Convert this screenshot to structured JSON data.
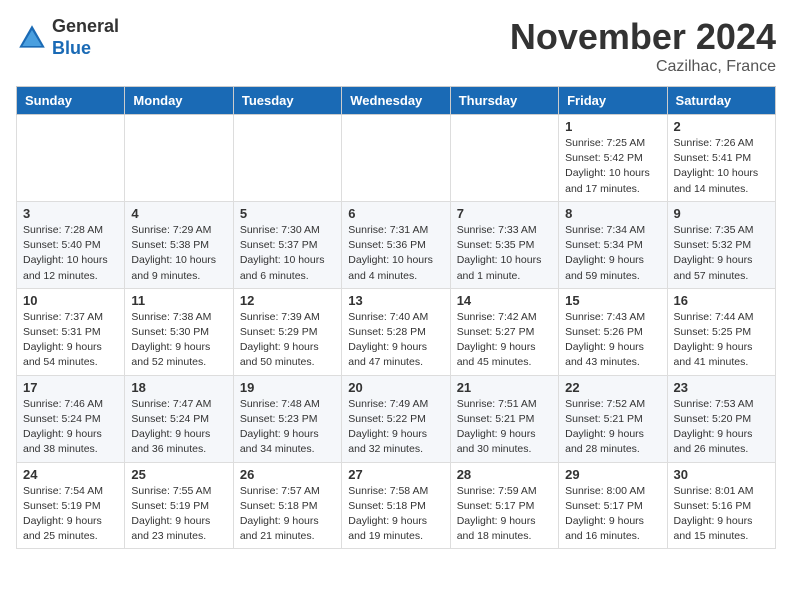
{
  "logo": {
    "line1": "General",
    "line2": "Blue"
  },
  "title": "November 2024",
  "location": "Cazilhac, France",
  "weekdays": [
    "Sunday",
    "Monday",
    "Tuesday",
    "Wednesday",
    "Thursday",
    "Friday",
    "Saturday"
  ],
  "weeks": [
    [
      null,
      null,
      null,
      null,
      null,
      {
        "day": "1",
        "sunrise": "Sunrise: 7:25 AM",
        "sunset": "Sunset: 5:42 PM",
        "daylight": "Daylight: 10 hours and 17 minutes."
      },
      {
        "day": "2",
        "sunrise": "Sunrise: 7:26 AM",
        "sunset": "Sunset: 5:41 PM",
        "daylight": "Daylight: 10 hours and 14 minutes."
      }
    ],
    [
      {
        "day": "3",
        "sunrise": "Sunrise: 7:28 AM",
        "sunset": "Sunset: 5:40 PM",
        "daylight": "Daylight: 10 hours and 12 minutes."
      },
      {
        "day": "4",
        "sunrise": "Sunrise: 7:29 AM",
        "sunset": "Sunset: 5:38 PM",
        "daylight": "Daylight: 10 hours and 9 minutes."
      },
      {
        "day": "5",
        "sunrise": "Sunrise: 7:30 AM",
        "sunset": "Sunset: 5:37 PM",
        "daylight": "Daylight: 10 hours and 6 minutes."
      },
      {
        "day": "6",
        "sunrise": "Sunrise: 7:31 AM",
        "sunset": "Sunset: 5:36 PM",
        "daylight": "Daylight: 10 hours and 4 minutes."
      },
      {
        "day": "7",
        "sunrise": "Sunrise: 7:33 AM",
        "sunset": "Sunset: 5:35 PM",
        "daylight": "Daylight: 10 hours and 1 minute."
      },
      {
        "day": "8",
        "sunrise": "Sunrise: 7:34 AM",
        "sunset": "Sunset: 5:34 PM",
        "daylight": "Daylight: 9 hours and 59 minutes."
      },
      {
        "day": "9",
        "sunrise": "Sunrise: 7:35 AM",
        "sunset": "Sunset: 5:32 PM",
        "daylight": "Daylight: 9 hours and 57 minutes."
      }
    ],
    [
      {
        "day": "10",
        "sunrise": "Sunrise: 7:37 AM",
        "sunset": "Sunset: 5:31 PM",
        "daylight": "Daylight: 9 hours and 54 minutes."
      },
      {
        "day": "11",
        "sunrise": "Sunrise: 7:38 AM",
        "sunset": "Sunset: 5:30 PM",
        "daylight": "Daylight: 9 hours and 52 minutes."
      },
      {
        "day": "12",
        "sunrise": "Sunrise: 7:39 AM",
        "sunset": "Sunset: 5:29 PM",
        "daylight": "Daylight: 9 hours and 50 minutes."
      },
      {
        "day": "13",
        "sunrise": "Sunrise: 7:40 AM",
        "sunset": "Sunset: 5:28 PM",
        "daylight": "Daylight: 9 hours and 47 minutes."
      },
      {
        "day": "14",
        "sunrise": "Sunrise: 7:42 AM",
        "sunset": "Sunset: 5:27 PM",
        "daylight": "Daylight: 9 hours and 45 minutes."
      },
      {
        "day": "15",
        "sunrise": "Sunrise: 7:43 AM",
        "sunset": "Sunset: 5:26 PM",
        "daylight": "Daylight: 9 hours and 43 minutes."
      },
      {
        "day": "16",
        "sunrise": "Sunrise: 7:44 AM",
        "sunset": "Sunset: 5:25 PM",
        "daylight": "Daylight: 9 hours and 41 minutes."
      }
    ],
    [
      {
        "day": "17",
        "sunrise": "Sunrise: 7:46 AM",
        "sunset": "Sunset: 5:24 PM",
        "daylight": "Daylight: 9 hours and 38 minutes."
      },
      {
        "day": "18",
        "sunrise": "Sunrise: 7:47 AM",
        "sunset": "Sunset: 5:24 PM",
        "daylight": "Daylight: 9 hours and 36 minutes."
      },
      {
        "day": "19",
        "sunrise": "Sunrise: 7:48 AM",
        "sunset": "Sunset: 5:23 PM",
        "daylight": "Daylight: 9 hours and 34 minutes."
      },
      {
        "day": "20",
        "sunrise": "Sunrise: 7:49 AM",
        "sunset": "Sunset: 5:22 PM",
        "daylight": "Daylight: 9 hours and 32 minutes."
      },
      {
        "day": "21",
        "sunrise": "Sunrise: 7:51 AM",
        "sunset": "Sunset: 5:21 PM",
        "daylight": "Daylight: 9 hours and 30 minutes."
      },
      {
        "day": "22",
        "sunrise": "Sunrise: 7:52 AM",
        "sunset": "Sunset: 5:21 PM",
        "daylight": "Daylight: 9 hours and 28 minutes."
      },
      {
        "day": "23",
        "sunrise": "Sunrise: 7:53 AM",
        "sunset": "Sunset: 5:20 PM",
        "daylight": "Daylight: 9 hours and 26 minutes."
      }
    ],
    [
      {
        "day": "24",
        "sunrise": "Sunrise: 7:54 AM",
        "sunset": "Sunset: 5:19 PM",
        "daylight": "Daylight: 9 hours and 25 minutes."
      },
      {
        "day": "25",
        "sunrise": "Sunrise: 7:55 AM",
        "sunset": "Sunset: 5:19 PM",
        "daylight": "Daylight: 9 hours and 23 minutes."
      },
      {
        "day": "26",
        "sunrise": "Sunrise: 7:57 AM",
        "sunset": "Sunset: 5:18 PM",
        "daylight": "Daylight: 9 hours and 21 minutes."
      },
      {
        "day": "27",
        "sunrise": "Sunrise: 7:58 AM",
        "sunset": "Sunset: 5:18 PM",
        "daylight": "Daylight: 9 hours and 19 minutes."
      },
      {
        "day": "28",
        "sunrise": "Sunrise: 7:59 AM",
        "sunset": "Sunset: 5:17 PM",
        "daylight": "Daylight: 9 hours and 18 minutes."
      },
      {
        "day": "29",
        "sunrise": "Sunrise: 8:00 AM",
        "sunset": "Sunset: 5:17 PM",
        "daylight": "Daylight: 9 hours and 16 minutes."
      },
      {
        "day": "30",
        "sunrise": "Sunrise: 8:01 AM",
        "sunset": "Sunset: 5:16 PM",
        "daylight": "Daylight: 9 hours and 15 minutes."
      }
    ]
  ]
}
